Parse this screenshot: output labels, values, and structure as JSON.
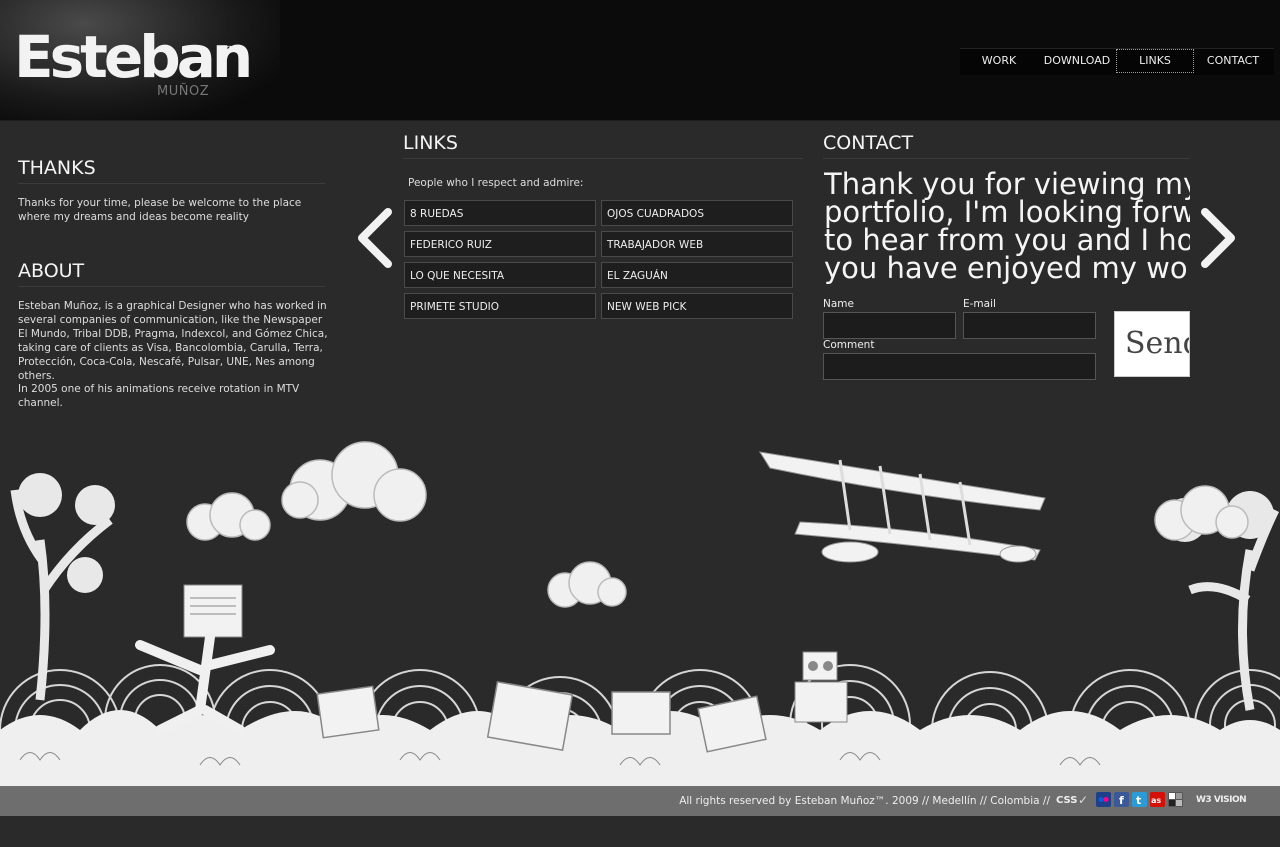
{
  "header": {
    "logo": {
      "name": "Esteban",
      "tm": "™",
      "subtitle": "MUÑOZ"
    },
    "nav": [
      {
        "label": "WORK",
        "active": false
      },
      {
        "label": "DOWNLOAD",
        "active": false
      },
      {
        "label": "LINKS",
        "active": true
      },
      {
        "label": "CONTACT",
        "active": false
      }
    ]
  },
  "left": {
    "thanks": {
      "title": "THANKS",
      "text": "Thanks for your time, please be welcome to the place where my dreams and ideas become reality"
    },
    "about": {
      "title": "ABOUT",
      "text1": "Esteban Muñoz, is a graphical Designer who has worked in several companies of communication, like the Newspaper El Mundo, Tribal DDB, Pragma, Indexcol, and Gómez Chica, taking care of clients as Visa, Bancolombia, Carulla, Terra, Protección, Coca-Cola, Nescafé, Pulsar, UNE, Nes among others.",
      "text2": "In 2005 one of his animations receive rotation in MTV channel."
    }
  },
  "links": {
    "title": "LINKS",
    "intro": "People who I respect and admire:",
    "items": [
      "8 RUEDAS",
      "OJOS CUADRADOS",
      "FEDERICO RUIZ",
      "TRABAJADOR WEB",
      "LO QUE NECESITA",
      "EL ZAGUÁN",
      "PRIMETE STUDIO",
      "NEW WEB PICK"
    ]
  },
  "contact": {
    "title": "CONTACT",
    "message_lines": [
      "Thank you for viewing my",
      "portfolio, I'm looking forwar",
      "to hear from you and I hope",
      "you have enjoyed my work."
    ],
    "name_label": "Name",
    "email_label": "E-mail",
    "comment_label": "Comment",
    "send_label": "Send"
  },
  "arrows": {
    "prev_icon": "chevron-left-icon",
    "next_icon": "chevron-right-icon"
  },
  "footer": {
    "copyright": "All rights reserved by Esteban Muñoz™. 2009 // Medellín // Colombia //",
    "css_label": "CSS",
    "social_icons": [
      "flickr-icon",
      "facebook-icon",
      "twitter-icon",
      "lastfm-icon",
      "delicious-icon"
    ],
    "brand_label": "W3 VISION"
  },
  "colors": {
    "background": "#2a2a2a",
    "header": "#0b0b0b",
    "footer": "#6e6e6e",
    "social": [
      "#1e3f8a",
      "#3b5998",
      "#2a9bd6",
      "#d51007",
      "#555555"
    ]
  }
}
